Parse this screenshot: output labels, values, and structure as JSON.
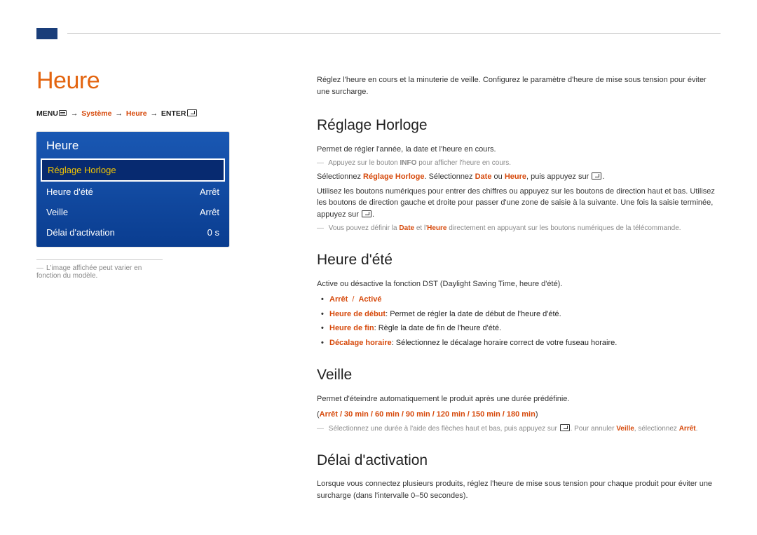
{
  "page": {
    "title": "Heure",
    "intro": "Réglez l'heure en cours et la minuterie de veille. Configurez le paramètre d'heure de mise sous tension pour éviter une surcharge."
  },
  "breadcrumb": {
    "menu_label": "MENU",
    "arrow": "→",
    "seg1": "Système",
    "seg2": "Heure",
    "enter_label": "ENTER"
  },
  "osd": {
    "title": "Heure",
    "rows": {
      "reglage_horloge": {
        "label": "Réglage Horloge",
        "value": ""
      },
      "heure_ete": {
        "label": "Heure d'été",
        "value": "Arrêt"
      },
      "veille": {
        "label": "Veille",
        "value": "Arrêt"
      },
      "delai": {
        "label": "Délai d'activation",
        "value": "0 s"
      }
    }
  },
  "left_note": "L'image affichée peut varier en fonction du modèle.",
  "sections": {
    "reglage_horloge": {
      "heading": "Réglage Horloge",
      "p1": "Permet de régler l'année, la date et l'heure en cours.",
      "note1_a": "Appuyez sur le bouton ",
      "note1_b": "INFO",
      "note1_c": " pour afficher l'heure en cours.",
      "p2_a": "Sélectionnez ",
      "p2_b": "Réglage Horloge",
      "p2_c": ". Sélectionnez ",
      "p2_d": "Date",
      "p2_e": " ou ",
      "p2_f": "Heure",
      "p2_g": ", puis appuyez sur ",
      "p3": "Utilisez les boutons numériques pour entrer des chiffres ou appuyez sur les boutons de direction haut et bas. Utilisez les boutons de direction gauche et droite pour passer d'une zone de saisie à la suivante. Une fois la saisie terminée, appuyez sur ",
      "note2_a": "Vous pouvez définir la ",
      "note2_b": "Date",
      "note2_c": " et l'",
      "note2_d": "Heure",
      "note2_e": " directement en appuyant sur les boutons numériques de la télécommande."
    },
    "heure_ete": {
      "heading": "Heure d'été",
      "p1": "Active ou désactive la fonction DST (Daylight Saving Time, heure d'été).",
      "opt_arret": "Arrêt",
      "opt_active": "Activé",
      "b2_label": "Heure de début",
      "b2_text": ": Permet de régler la date de début de l'heure d'été.",
      "b3_label": "Heure de fin",
      "b3_text": ": Règle la date de fin de l'heure d'été.",
      "b4_label": "Décalage horaire",
      "b4_text": ": Sélectionnez le décalage horaire correct de votre fuseau horaire."
    },
    "veille": {
      "heading": "Veille",
      "p1": "Permet d'éteindre automatiquement le produit après une durée prédéfinie.",
      "opts": [
        "Arrêt",
        "30 min",
        "60 min",
        "90 min",
        "120 min",
        "150 min",
        "180 min"
      ],
      "note_a": "Sélectionnez une durée à l'aide des flèches haut et bas, puis appuyez sur ",
      "note_b": ". Pour annuler ",
      "note_c": "Veille",
      "note_d": ", sélectionnez ",
      "note_e": "Arrêt",
      "note_f": "."
    },
    "delai": {
      "heading": "Délai d'activation",
      "p1": "Lorsque vous connectez plusieurs produits, réglez l'heure de mise sous tension pour chaque produit pour éviter une surcharge (dans l'intervalle 0–50 secondes)."
    }
  }
}
